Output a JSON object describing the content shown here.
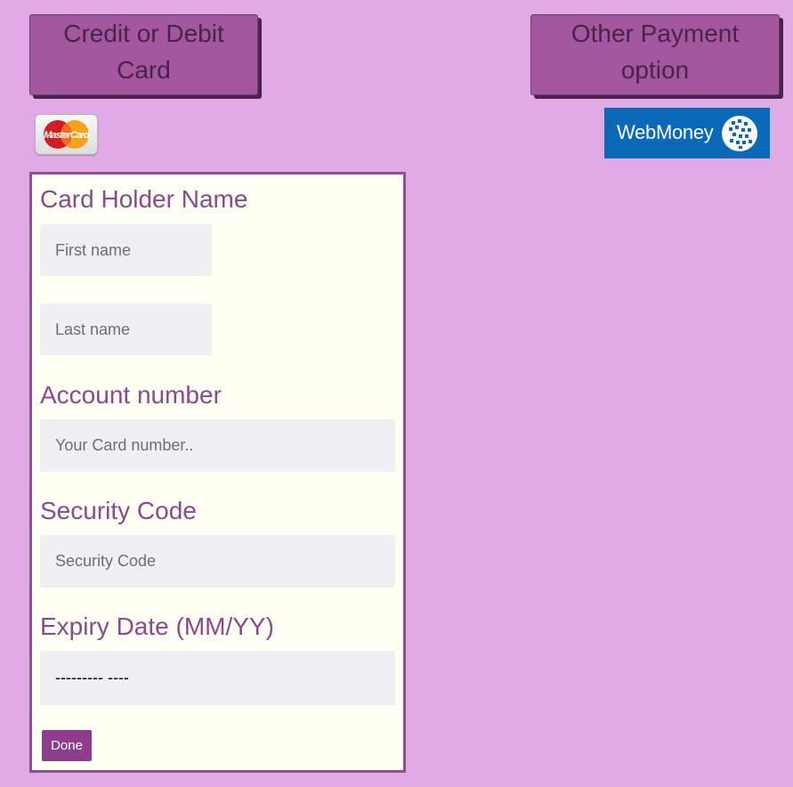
{
  "payment_tabs": {
    "card_label": "Credit or Debit Card",
    "other_label": "Other Payment option"
  },
  "logos": {
    "mastercard_text": "MasterCard",
    "webmoney_text": "WebMoney"
  },
  "form": {
    "card_holder_label": "Card Holder Name",
    "first_name_placeholder": "First name",
    "last_name_placeholder": "Last name",
    "account_label": "Account number",
    "card_number_placeholder": "Your Card number..",
    "security_label": "Security Code",
    "security_placeholder": "Security Code",
    "expiry_label": "Expiry Date (MM/YY)",
    "expiry_value": "--------- ----",
    "done_label": "Done"
  },
  "colors": {
    "page_background": "#dfaae6",
    "tab_button": "#a2579f",
    "form_background": "#fffff3",
    "label_text": "#8b4a8e",
    "field_background": "#f0f0f4",
    "done_button": "#8e3d8c",
    "webmoney_blue": "#0b6ab7"
  }
}
